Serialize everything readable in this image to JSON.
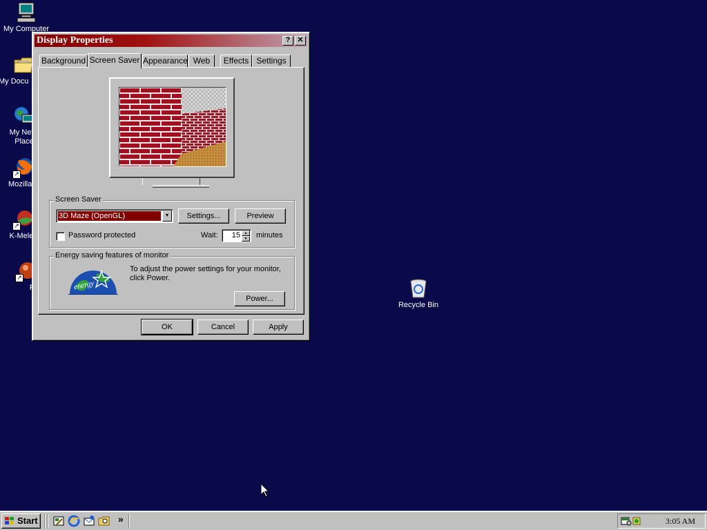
{
  "desktop": {
    "icons": [
      {
        "label": "My Computer"
      },
      {
        "label": "My Docu"
      },
      {
        "label": "My Netw Place"
      },
      {
        "label": "Mozilla F"
      },
      {
        "label": "K-Meleo"
      },
      {
        "label": "Peg"
      },
      {
        "label": "Recycle Bin"
      }
    ]
  },
  "window": {
    "title": "Display Properties",
    "help_button": "?",
    "close_button": "✕",
    "tabs": [
      {
        "label": "Background"
      },
      {
        "label": "Screen Saver",
        "active": true
      },
      {
        "label": "Appearance"
      },
      {
        "label": "Web"
      },
      {
        "label": "Effects"
      },
      {
        "label": "Settings"
      }
    ],
    "screen_saver_group": {
      "legend": "Screen Saver",
      "selected": "3D Maze (OpenGL)",
      "settings_button": "Settings...",
      "preview_button": "Preview",
      "password_label": "Password protected",
      "password_checked": false,
      "wait_label": "Wait:",
      "wait_value": "15",
      "wait_unit": "minutes"
    },
    "energy_group": {
      "legend": "Energy saving features of monitor",
      "description": "To adjust the power settings for your monitor, click Power.",
      "power_button": "Power...",
      "logo_text": "energy"
    },
    "buttons": {
      "ok": "OK",
      "cancel": "Cancel",
      "apply": "Apply"
    }
  },
  "taskbar": {
    "start_label": "Start",
    "chevron": "»",
    "clock": "3:05 AM"
  },
  "colors": {
    "desktop": "#0a0a4a",
    "titlebar_start": "#800000",
    "dropdown_selection": "#800000"
  }
}
